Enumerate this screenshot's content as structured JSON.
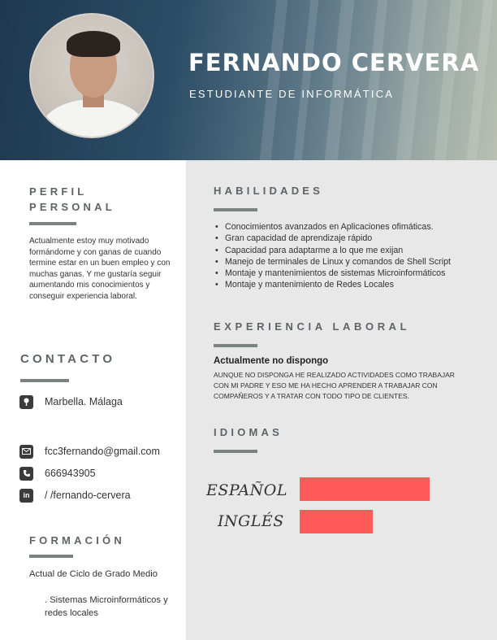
{
  "header": {
    "name": "FERNANDO CERVERA",
    "subtitle": "ESTUDIANTE DE INFORMÁTICA"
  },
  "profile": {
    "title_line1": "PERFIL",
    "title_line2": "PERSONAL",
    "text": "Actualmente estoy muy motivado formándome y con ganas de cuando termine estar en un buen empleo  y con muchas ganas. Y me gustaría seguir aumentando mis conocimientos y conseguir experiencia laboral."
  },
  "contact": {
    "title": "CONTACTO",
    "location": "Marbella. Málaga",
    "email": "fcc3fernando@gmail.com",
    "phone": "666943905",
    "linkedin": "/ /fernando-cervera",
    "icons": [
      "location-icon",
      "email-icon",
      "phone-icon",
      "linkedin-icon"
    ]
  },
  "education": {
    "title": "FORMACIÓN",
    "line1": "Actual de Ciclo de Grado Medio",
    "line2": ". Sistemas Microinformáticos y redes locales"
  },
  "skills": {
    "title": "HABILIDADES",
    "items": [
      "Conocimientos avanzados en Aplicaciones ofimáticas.",
      "Gran capacidad de aprendizaje rápido",
      "Capacidad para adaptarme a lo que me exijan",
      "Manejo de terminales de Linux y comandos de Shell Script",
      "Montaje y mantenimientos de sistemas Microinformáticos",
      "Montaje y mantenimiento de Redes Locales"
    ]
  },
  "experience": {
    "title": "EXPERIENCIA LABORAL",
    "heading": "Actualmente no dispongo",
    "body": "AUNQUE NO DISPONGA HE REALIZADO ACTIVIDADES COMO TRABAJAR CON MI PADRE Y ESO ME HA HECHO APRENDER A TRABAJAR CON COMPAÑEROS Y A TRATAR CON TODO TIPO DE CLIENTES."
  },
  "languages": {
    "title": "IDIOMAS",
    "items": [
      {
        "label": "ESPAÑOL",
        "level": 1.0
      },
      {
        "label": "INGLÉS",
        "level": 0.56
      }
    ],
    "bar_color": "#ff5a5a"
  },
  "colors": {
    "header_dark": "#1e3850",
    "right_panel": "#e8e8e9",
    "section_title": "#5d6466",
    "accent_bar": "#7a8284",
    "icon_bg": "#3b3b3d"
  }
}
